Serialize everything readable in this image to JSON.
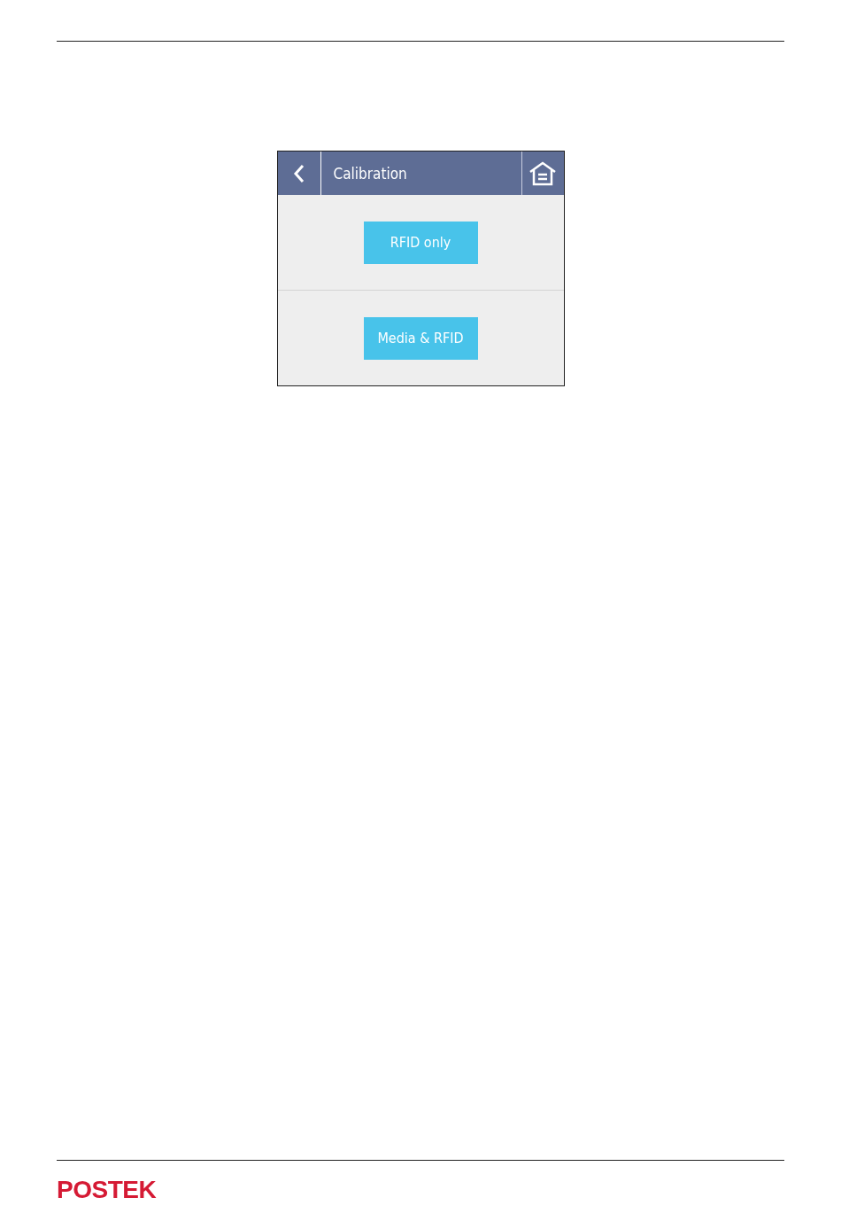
{
  "screen": {
    "title": "Calibration",
    "buttons": [
      {
        "label": "RFID only"
      },
      {
        "label": "Media & RFID"
      }
    ]
  },
  "footer": {
    "logo": "POSTEK"
  }
}
